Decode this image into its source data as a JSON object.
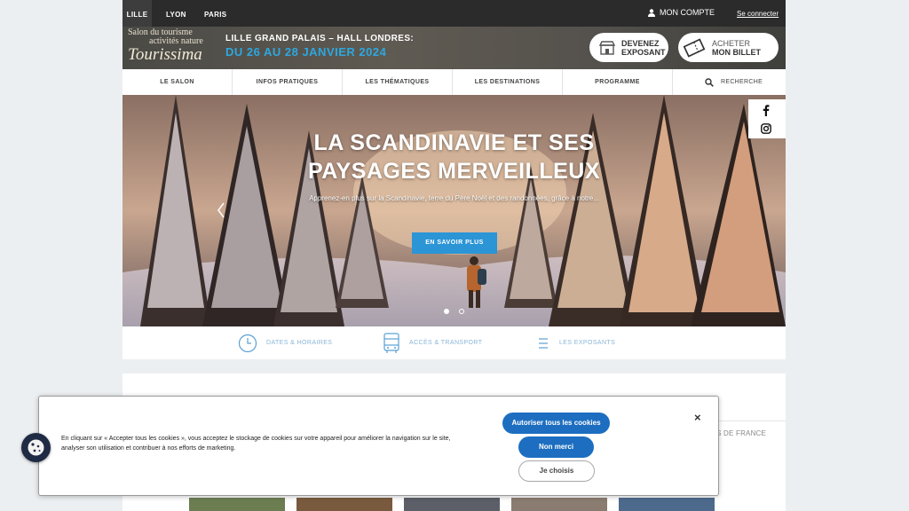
{
  "topbar": {
    "cities": [
      "LILLE",
      "LYON",
      "PARIS"
    ],
    "account_label": "MON COMPTE",
    "connect_label": "Se connecter"
  },
  "banner": {
    "logo_line1": "Salon du tourisme",
    "logo_line2": "activités nature",
    "logo_brand": "Tourissima",
    "event_line1": "LILLE GRAND PALAIS – HALL LONDRES:",
    "event_dates": "DU 26 AU 28 JANVIER 2024",
    "exhibitor_line1": "DEVENEZ",
    "exhibitor_line2": "EXPOSANT",
    "ticket_line1": "ACHETER",
    "ticket_line2": "MON BILLET"
  },
  "nav": {
    "items": [
      "LE SALON",
      "INFOS PRATIQUES",
      "LES THÉMATIQUES",
      "LES DESTINATIONS",
      "PROGRAMME"
    ],
    "search_label": "RECHERCHE"
  },
  "hero": {
    "title_line1": "LA SCANDINAVIE ET SES",
    "title_line2": "PAYSAGES MERVEILLEUX",
    "subtitle": "Apprenez-en plus sur la Scandinavie, terre du Père Noël et des randonnées, grâce à notre...",
    "cta_label": "EN SAVOIR PLUS",
    "slide_count": 2,
    "active_slide": 1
  },
  "info": {
    "items": [
      "DATES & HORAIRES",
      "ACCÈS & TRANSPORT",
      "LES EXPOSANTS"
    ]
  },
  "content": {
    "partial_tag": "TS DE FRANCE"
  },
  "cookie": {
    "text": "En cliquant sur « Accepter tous les cookies », vous acceptez le stockage de cookies sur votre appareil pour améliorer la navigation sur le site, analyser son utilisation et contribuer à nos efforts de marketing.",
    "accept_all": "Autoriser tous les cookies",
    "decline": "Non merci",
    "choose": "Je choisis",
    "close": "×"
  },
  "colors": {
    "accent_blue": "#2b95d6",
    "date_blue": "#2ca8e0",
    "cookie_blue": "#1d6ec0",
    "topbar": "#2b2b2b"
  }
}
